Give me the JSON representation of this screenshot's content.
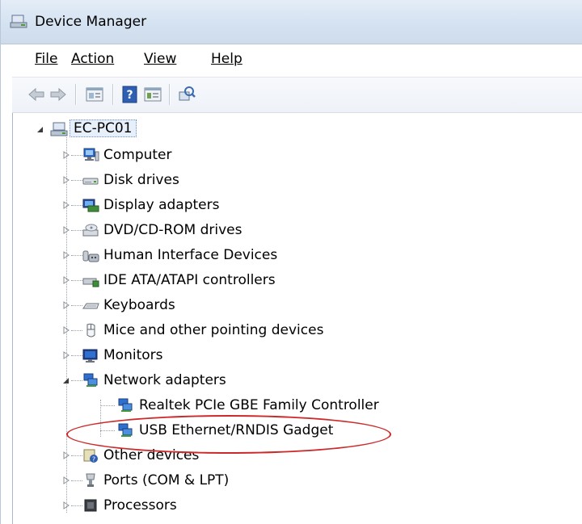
{
  "window": {
    "title": "Device Manager"
  },
  "menu": {
    "file": "File",
    "action": "Action",
    "view": "View",
    "help": "Help"
  },
  "toolbar": [
    "back-icon",
    "forward-icon",
    "show-hide-console-tree-icon",
    "help-icon",
    "properties-icon",
    "scan-hardware-icon"
  ],
  "tree": {
    "root": "EC-PC01",
    "categories": [
      {
        "label": "Computer",
        "icon": "computer-icon",
        "expanded": false
      },
      {
        "label": "Disk drives",
        "icon": "disk-drive-icon",
        "expanded": false
      },
      {
        "label": "Display adapters",
        "icon": "display-adapter-icon",
        "expanded": false
      },
      {
        "label": "DVD/CD-ROM drives",
        "icon": "dvd-drive-icon",
        "expanded": false
      },
      {
        "label": "Human Interface Devices",
        "icon": "hid-icon",
        "expanded": false
      },
      {
        "label": "IDE ATA/ATAPI controllers",
        "icon": "ide-controller-icon",
        "expanded": false
      },
      {
        "label": "Keyboards",
        "icon": "keyboard-icon",
        "expanded": false
      },
      {
        "label": "Mice and other pointing devices",
        "icon": "mouse-icon",
        "expanded": false
      },
      {
        "label": "Monitors",
        "icon": "monitor-icon",
        "expanded": false
      },
      {
        "label": "Network adapters",
        "icon": "network-adapter-icon",
        "expanded": true,
        "children": [
          "Realtek PCIe GBE Family Controller",
          "USB Ethernet/RNDIS Gadget"
        ]
      },
      {
        "label": "Other devices",
        "icon": "other-devices-icon",
        "expanded": false
      },
      {
        "label": "Ports (COM & LPT)",
        "icon": "port-icon",
        "expanded": false
      },
      {
        "label": "Processors",
        "icon": "processor-icon",
        "expanded": false
      }
    ]
  },
  "annotation": {
    "highlighted_item": "USB Ethernet/RNDIS Gadget",
    "color": "#cc2a2a"
  }
}
